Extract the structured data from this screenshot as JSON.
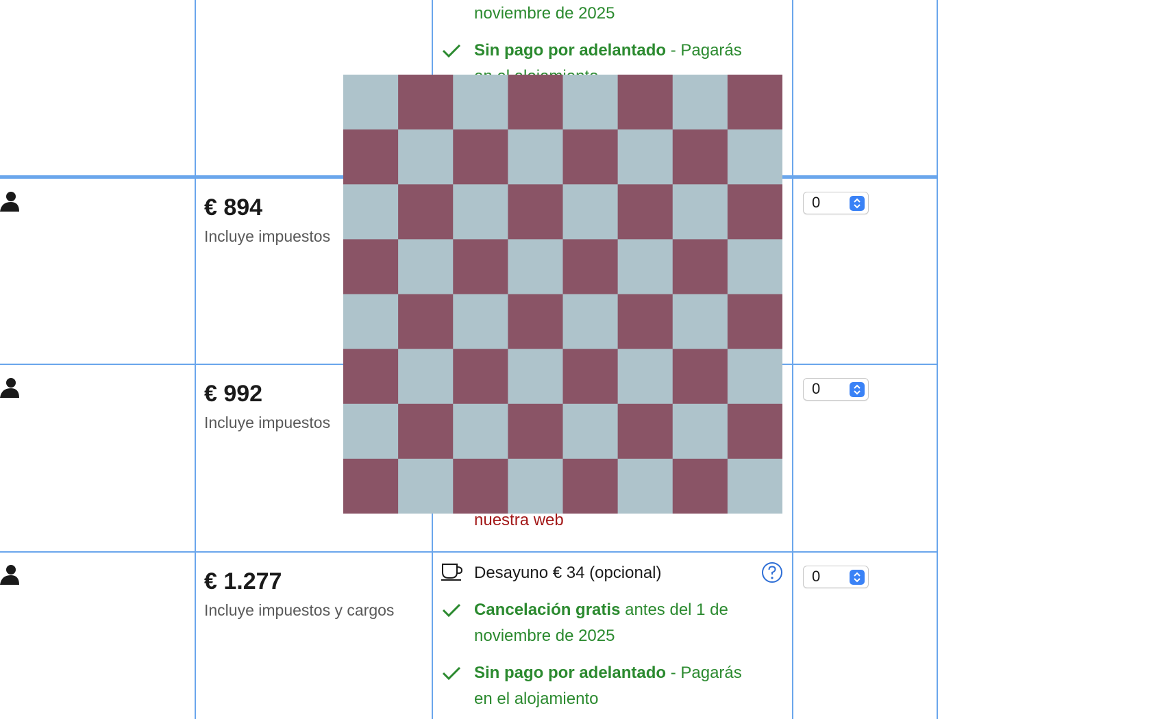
{
  "rows": [
    {
      "price": "€ 894",
      "taxes": "Incluye impuestos",
      "quantity": "0"
    },
    {
      "price": "€ 992",
      "taxes": "Incluye impuestos",
      "quantity": "0",
      "partial_text": "nuestra web"
    },
    {
      "price": "€ 1.277",
      "taxes": "Incluye impuestos y cargos",
      "quantity": "0",
      "breakfast": "Desayuno € 34 (opcional)",
      "cancel_bold": "Cancelación gratis",
      "cancel_rest": " antes del 1 de",
      "cancel_line2": "noviembre de 2025",
      "prepay_bold": "Sin pago por adelantado",
      "prepay_rest": " - Pagarás",
      "prepay_line2": "en el alojamiento"
    }
  ],
  "top_row": {
    "cancel_line2": "noviembre de 2025",
    "prepay_bold": "Sin pago por adelantado",
    "prepay_rest": " - Pagarás",
    "prepay_line2_partial": "en el alojamiento"
  },
  "colors": {
    "grid_line": "#6aa6ec",
    "green_text": "#2b8a2f",
    "red_text": "#a31a1a",
    "stepper_button": "#3a82f6",
    "checker_light": "#aec3cb",
    "checker_dark": "#8a5466"
  },
  "icons": {
    "check": "check-icon",
    "person": "person-icon",
    "cup": "coffee-cup-icon",
    "help": "help-icon",
    "stepper": "chevron-updown-icon"
  }
}
